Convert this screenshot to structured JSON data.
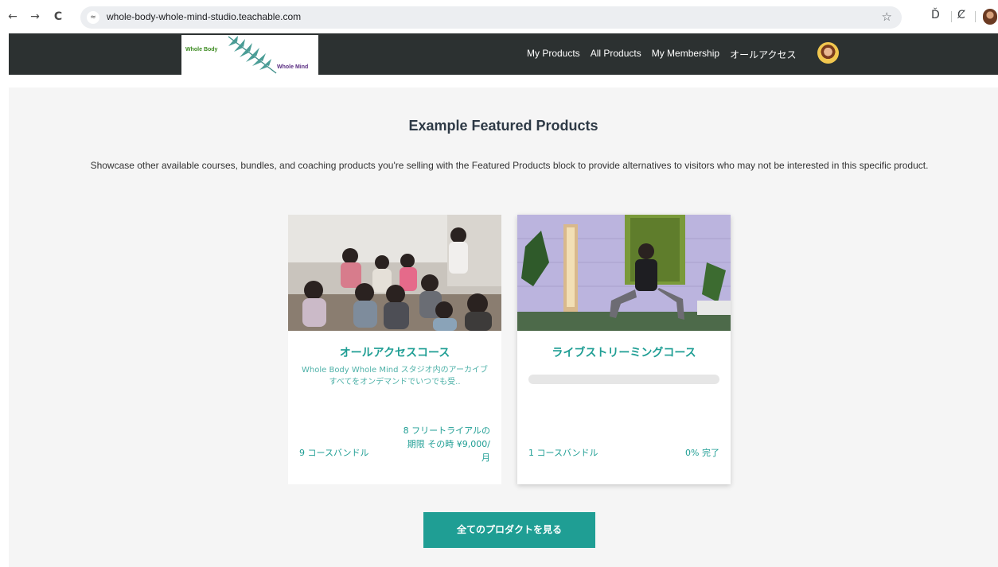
{
  "browser": {
    "url": "whole-body-whole-mind-studio.teachable.com",
    "back_glyph": "←",
    "forward_glyph": "→",
    "reload_glyph": "C",
    "star_glyph": "☆",
    "extensions_glyph": "Ď",
    "reading_glyph": "Ȼ",
    "tune_glyph": "≈"
  },
  "header": {
    "logo_line1": "Whole Body",
    "logo_line2": "Whole Mind",
    "menu": [
      {
        "label": "My Products"
      },
      {
        "label": "All Products"
      },
      {
        "label": "My Membership"
      },
      {
        "label": "オールアクセス"
      }
    ]
  },
  "section": {
    "heading": "Example Featured Products",
    "description": "Showcase other available courses, bundles, and coaching products you're selling with the Featured Products block to provide alternatives to visitors who may not be interested in this specific product."
  },
  "cards": [
    {
      "title": "オールアクセスコース",
      "description": "Whole Body Whole Mind スタジオ内のアーカイブすべてをオンデマンドでいつでも受..",
      "bundle": "9 コースバンドル",
      "price": "8 フリートライアルの期限 その時 ¥9,000/月"
    },
    {
      "title": "ライブストリーミングコース",
      "progress": 0,
      "bundle": "1 コースバンドル",
      "completion": "0% 完了"
    }
  ],
  "cta": {
    "label": "全てのプロダクトを見る"
  },
  "colors": {
    "accent": "#1f9e94",
    "header_bg": "#2c3131",
    "section_bg": "#f5f5f5"
  }
}
